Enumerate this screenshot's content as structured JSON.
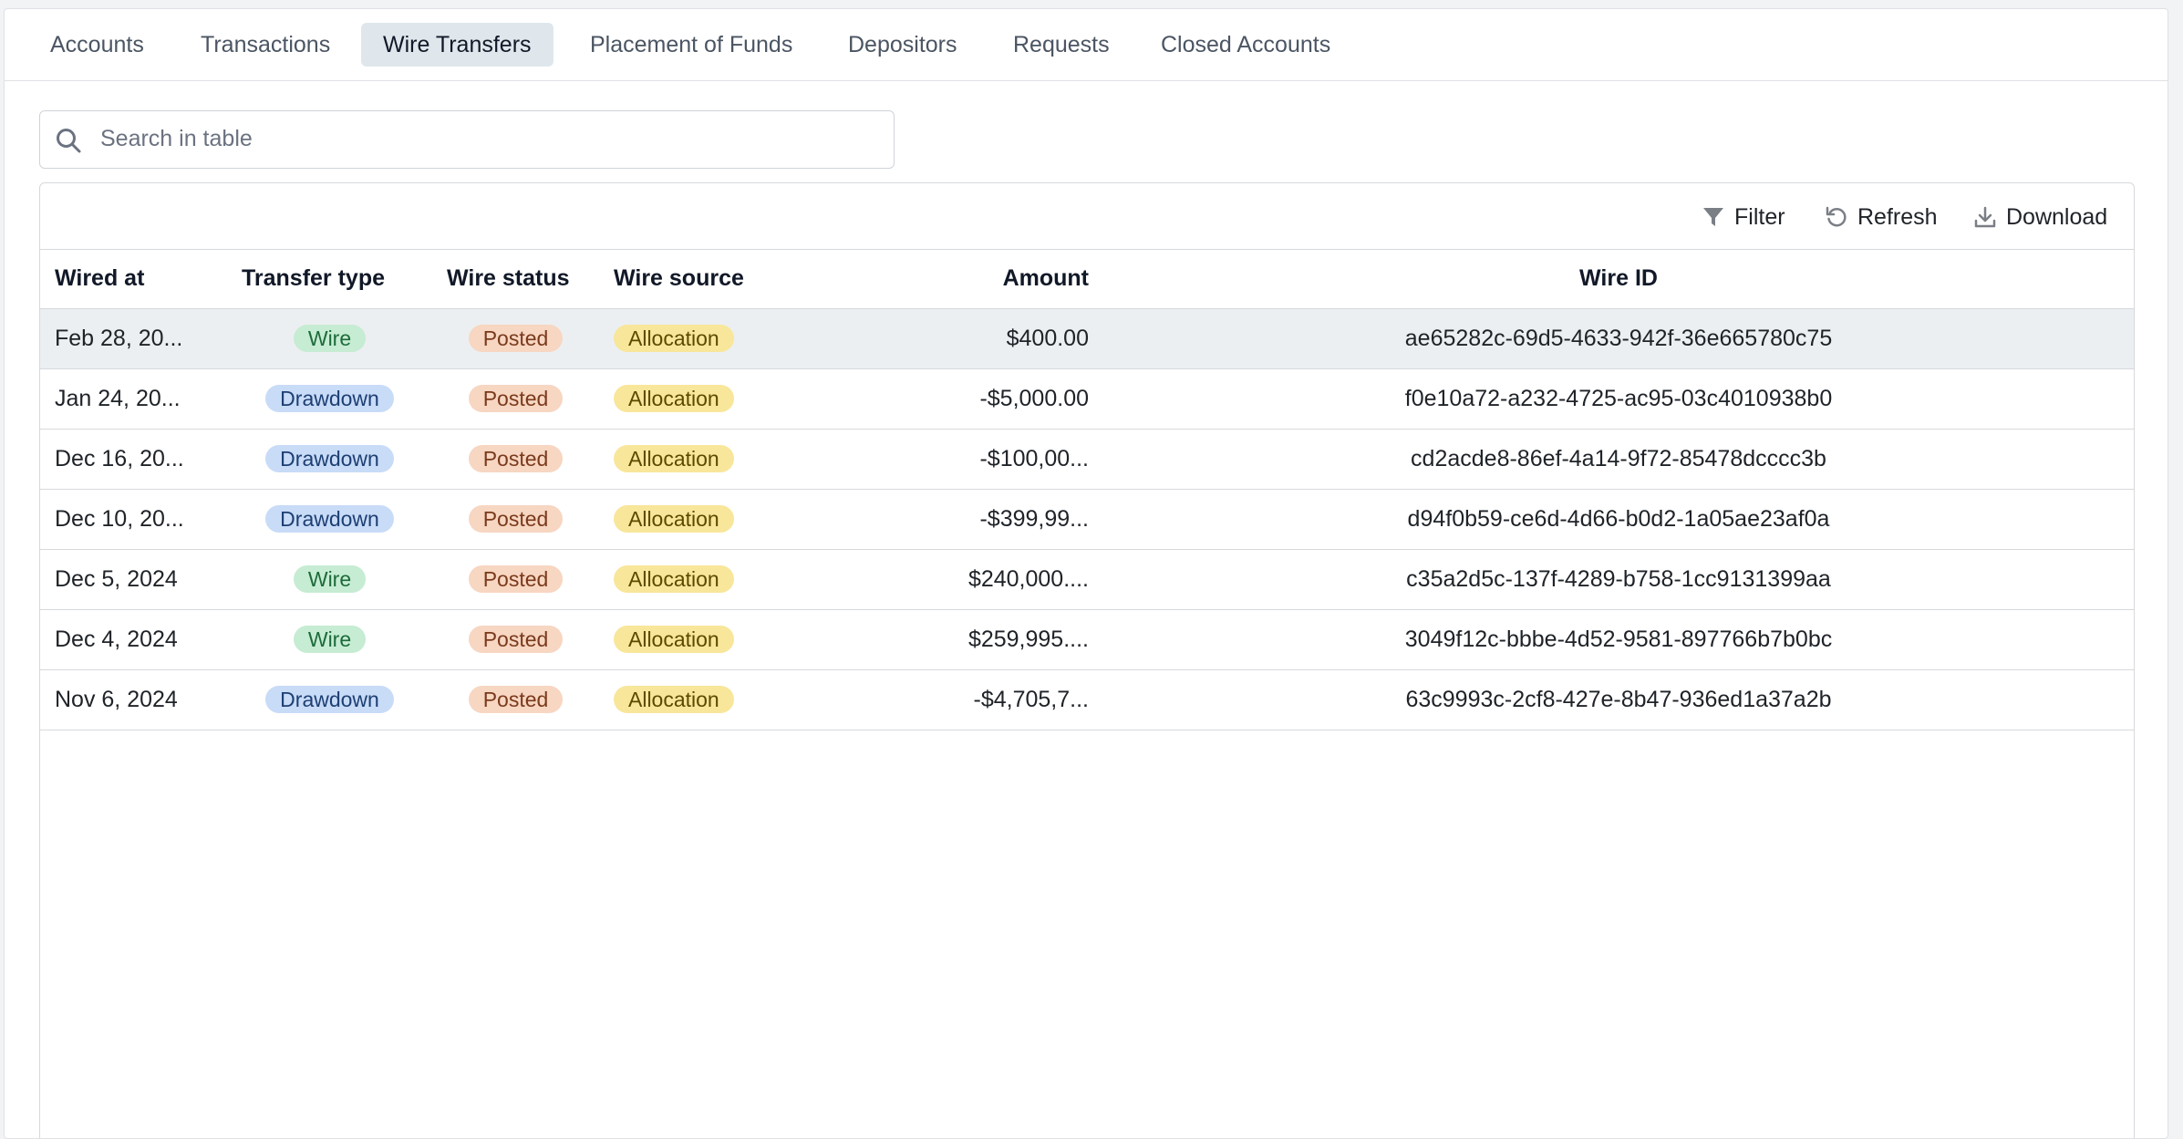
{
  "tabs": [
    {
      "label": "Accounts",
      "active": false
    },
    {
      "label": "Transactions",
      "active": false
    },
    {
      "label": "Wire Transfers",
      "active": true
    },
    {
      "label": "Placement of Funds",
      "active": false
    },
    {
      "label": "Depositors",
      "active": false
    },
    {
      "label": "Requests",
      "active": false
    },
    {
      "label": "Closed Accounts",
      "active": false
    }
  ],
  "search": {
    "placeholder": "Search in table",
    "value": "",
    "icon": "search-icon"
  },
  "toolbar": {
    "filter_label": "Filter",
    "filter_icon": "filter-icon",
    "refresh_label": "Refresh",
    "refresh_icon": "refresh-icon",
    "download_label": "Download",
    "download_icon": "download-icon"
  },
  "table": {
    "columns": [
      "Wired at",
      "Transfer type",
      "Wire status",
      "Wire source",
      "Amount",
      "Wire ID"
    ],
    "rows": [
      {
        "wired_at": "Feb 28, 20...",
        "transfer_type": "Wire",
        "wire_status": "Posted",
        "wire_source": "Allocation",
        "amount": "$400.00",
        "wire_id": "ae65282c-69d5-4633-942f-36e665780c75",
        "selected": true
      },
      {
        "wired_at": "Jan 24, 20...",
        "transfer_type": "Drawdown",
        "wire_status": "Posted",
        "wire_source": "Allocation",
        "amount": "-$5,000.00",
        "wire_id": "f0e10a72-a232-4725-ac95-03c4010938b0",
        "selected": false
      },
      {
        "wired_at": "Dec 16, 20...",
        "transfer_type": "Drawdown",
        "wire_status": "Posted",
        "wire_source": "Allocation",
        "amount": "-$100,00...",
        "wire_id": "cd2acde8-86ef-4a14-9f72-85478dcccc3b",
        "selected": false
      },
      {
        "wired_at": "Dec 10, 20...",
        "transfer_type": "Drawdown",
        "wire_status": "Posted",
        "wire_source": "Allocation",
        "amount": "-$399,99...",
        "wire_id": "d94f0b59-ce6d-4d66-b0d2-1a05ae23af0a",
        "selected": false
      },
      {
        "wired_at": "Dec 5, 2024",
        "transfer_type": "Wire",
        "wire_status": "Posted",
        "wire_source": "Allocation",
        "amount": "$240,000....",
        "wire_id": "c35a2d5c-137f-4289-b758-1cc9131399aa",
        "selected": false
      },
      {
        "wired_at": "Dec 4, 2024",
        "transfer_type": "Wire",
        "wire_status": "Posted",
        "wire_source": "Allocation",
        "amount": "$259,995....",
        "wire_id": "3049f12c-bbbe-4d52-9581-897766b7b0bc",
        "selected": false
      },
      {
        "wired_at": "Nov 6, 2024",
        "transfer_type": "Drawdown",
        "wire_status": "Posted",
        "wire_source": "Allocation",
        "amount": "-$4,705,7...",
        "wire_id": "63c9993c-2cf8-427e-8b47-936ed1a37a2b",
        "selected": false
      }
    ]
  },
  "colors": {
    "active_tab_bg": "#dfe7ec",
    "wire_badge": "#c6ecd3",
    "drawdown_badge": "#c8dbf7",
    "posted_badge": "#f7d6c2",
    "allocation_badge": "#f8e69a"
  }
}
